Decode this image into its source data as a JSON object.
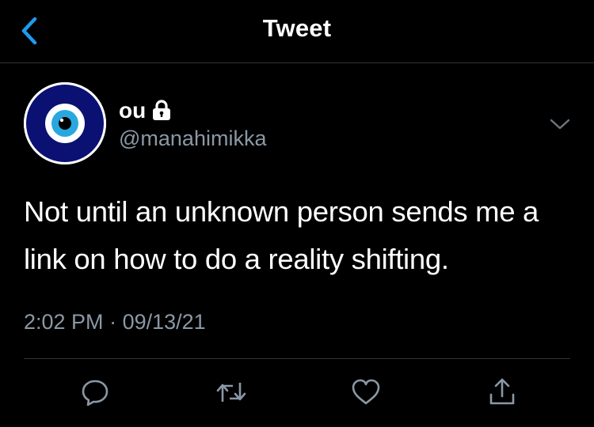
{
  "header": {
    "title": "Tweet",
    "back_icon": "chevron-left-icon"
  },
  "author": {
    "display_name": "ou",
    "handle": "@manahimikka",
    "protected_icon": "lock-icon",
    "avatar_icon": "evil-eye-icon"
  },
  "tweet": {
    "text": "Not until an unknown person sends me a link on how to do a reality shifting.",
    "time": "2:02 PM",
    "separator": "·",
    "date": "09/13/21"
  },
  "actions": [
    {
      "name": "reply",
      "icon": "reply-icon"
    },
    {
      "name": "retweet",
      "icon": "retweet-icon"
    },
    {
      "name": "like",
      "icon": "heart-icon"
    },
    {
      "name": "share",
      "icon": "share-icon"
    }
  ],
  "colors": {
    "background": "#000000",
    "accent": "#1d9bf0",
    "secondary_text": "#8b98a5",
    "divider": "#2f3336",
    "avatar_navy": "#0a1172"
  }
}
